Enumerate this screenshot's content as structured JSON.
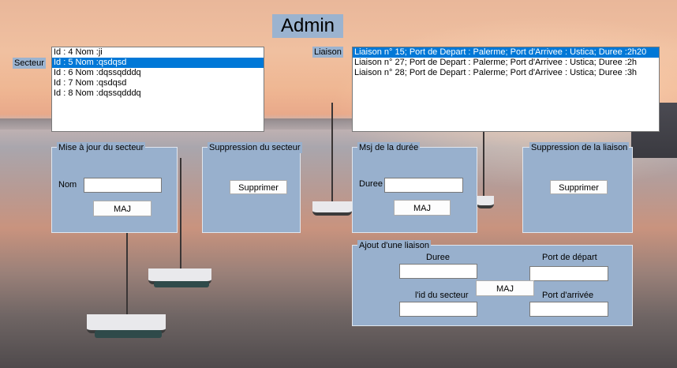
{
  "window": {
    "title": "Admin"
  },
  "secteur": {
    "label": "Secteur",
    "items": [
      {
        "text": "Id : 4 Nom :ji",
        "selected": false
      },
      {
        "text": "Id : 5 Nom :qsdqsd",
        "selected": true
      },
      {
        "text": "Id : 6 Nom :dqssqdddq",
        "selected": false
      },
      {
        "text": "Id : 7 Nom :qsdqsd",
        "selected": false
      },
      {
        "text": "Id : 8 Nom :dqssqdddq",
        "selected": false
      }
    ]
  },
  "liaison": {
    "label": "Liaison",
    "items": [
      {
        "text": "Liaison n° 15; Port de Depart : Palerme; Port d'Arrivee : Ustica; Duree :2h20",
        "selected": true
      },
      {
        "text": "Liaison n° 27; Port de Depart : Palerme; Port d'Arrivee : Ustica; Duree :2h",
        "selected": false
      },
      {
        "text": "Liaison n° 28; Port de Depart : Palerme; Port d'Arrivee : Ustica; Duree :3h",
        "selected": false
      }
    ]
  },
  "maj_secteur": {
    "title": "Mise à jour du secteur",
    "nom_label": "Nom",
    "nom_value": "",
    "button": "MAJ"
  },
  "suppr_secteur": {
    "title": "Suppression du secteur",
    "button": "Supprimer"
  },
  "maj_duree": {
    "title": "Msj de la durée",
    "duree_label": "Duree",
    "duree_value": "",
    "button": "MAJ"
  },
  "suppr_liaison": {
    "title": "Suppression de la liaison",
    "button": "Supprimer"
  },
  "ajout_liaison": {
    "title": "Ajout d'une liaison",
    "duree_label": "Duree",
    "port_depart_label": "Port de départ",
    "id_secteur_label": "l'id du secteur",
    "port_arrivee_label": "Port d'arrivée",
    "duree_value": "",
    "port_depart_value": "",
    "id_secteur_value": "",
    "port_arrivee_value": "",
    "button": "MAJ"
  },
  "colors": {
    "panel": "#98b0cd",
    "selection": "#0078d7"
  }
}
